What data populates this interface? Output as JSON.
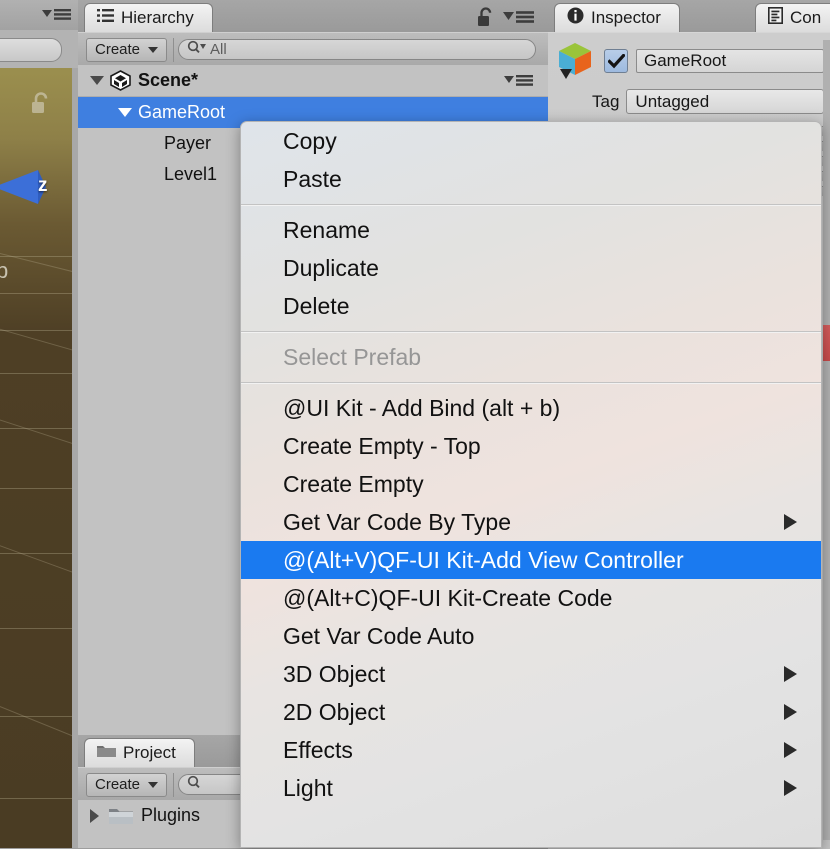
{
  "scene_view": {
    "gizmo_axis_label": "z",
    "partial_label": "p",
    "lock_icon": "unlock-icon"
  },
  "hierarchy": {
    "tab_label": "Hierarchy",
    "tab_icon": "hierarchy-list-icon",
    "lock_icon": "unlock-icon",
    "menu_icon": "panel-options-icon",
    "toolbar": {
      "create_label": "Create",
      "create_dropdown_icon": "chevron-down-icon",
      "search_icon": "search-icon",
      "search_placeholder": "All",
      "search_value": ""
    },
    "tree": [
      {
        "label": "Scene*",
        "icon": "unity-scene-icon",
        "expanded": true,
        "depth": 0,
        "selected": false
      },
      {
        "label": "GameRoot",
        "icon": "",
        "expanded": true,
        "depth": 1,
        "selected": true
      },
      {
        "label": "Payer",
        "icon": "",
        "expanded": false,
        "depth": 2,
        "selected": false
      },
      {
        "label": "Level1",
        "icon": "",
        "expanded": false,
        "depth": 2,
        "selected": false
      }
    ]
  },
  "project": {
    "tab_label": "Project",
    "tab_icon": "folder-icon",
    "toolbar": {
      "create_label": "Create",
      "create_dropdown_icon": "chevron-down-icon",
      "search_icon": "search-icon"
    },
    "tree": [
      {
        "label": "Plugins",
        "icon": "folder-icon",
        "expanded": false
      }
    ]
  },
  "inspector": {
    "tab_label": "Inspector",
    "tab_icon": "info-circle-icon",
    "second_tab_label": "Con",
    "second_tab_icon": "console-icon",
    "prefab_icon": "prefab-cube-icon",
    "enabled_checkbox": true,
    "object_name": "GameRoot",
    "tag_label": "Tag",
    "tag_value": "Untagged"
  },
  "context_menu": {
    "items": [
      {
        "label": "Copy",
        "type": "item",
        "submenu": false
      },
      {
        "label": "Paste",
        "type": "item",
        "submenu": false
      },
      {
        "label": "",
        "type": "separator",
        "submenu": false
      },
      {
        "label": "Rename",
        "type": "item",
        "submenu": false
      },
      {
        "label": "Duplicate",
        "type": "item",
        "submenu": false
      },
      {
        "label": "Delete",
        "type": "item",
        "submenu": false
      },
      {
        "label": "",
        "type": "separator",
        "submenu": false
      },
      {
        "label": "Select Prefab",
        "type": "disabled",
        "submenu": false
      },
      {
        "label": "",
        "type": "separator",
        "submenu": false
      },
      {
        "label": "@UI Kit - Add Bind (alt + b)",
        "type": "item",
        "submenu": false
      },
      {
        "label": "Create Empty - Top",
        "type": "item",
        "submenu": false
      },
      {
        "label": "Create Empty",
        "type": "item",
        "submenu": false
      },
      {
        "label": "Get Var Code By Type",
        "type": "item",
        "submenu": true
      },
      {
        "label": "@(Alt+V)QF-UI Kit-Add View Controller",
        "type": "highlight",
        "submenu": false
      },
      {
        "label": "@(Alt+C)QF-UI Kit-Create Code",
        "type": "item",
        "submenu": false
      },
      {
        "label": "Get Var Code Auto",
        "type": "item",
        "submenu": false
      },
      {
        "label": "3D Object",
        "type": "item",
        "submenu": true
      },
      {
        "label": "2D Object",
        "type": "item",
        "submenu": true
      },
      {
        "label": "Effects",
        "type": "item",
        "submenu": true
      },
      {
        "label": "Light",
        "type": "item",
        "submenu": true
      }
    ]
  },
  "colors": {
    "selection_blue": "#3f7fe0",
    "menu_highlight_blue": "#1a7af0",
    "panel_gray": "#c2c2c2",
    "chrome_gray": "#9d9d9d",
    "component_red": "#c74a4a"
  }
}
